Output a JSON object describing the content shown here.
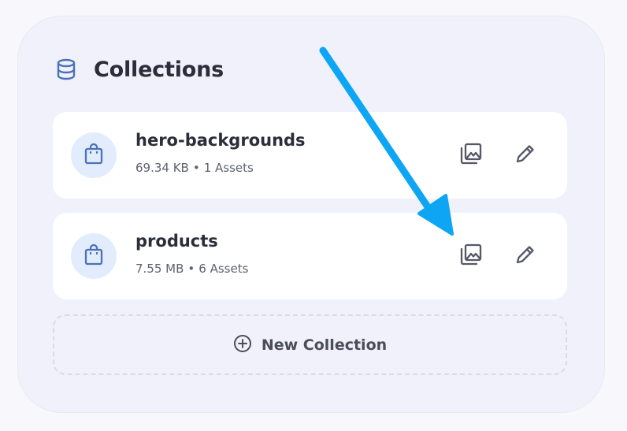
{
  "colors": {
    "page_bg": "#f7f7fc",
    "panel_bg": "#f0f1fa",
    "card_bg": "#ffffff",
    "avatar_bg": "#e3ecfc",
    "accent_blue": "#4a72b8",
    "annotation_arrow": "#0ea5f5",
    "icon_gray": "#555866",
    "title_text": "#2b2d3a"
  },
  "header": {
    "icon": "database-icon",
    "title": "Collections"
  },
  "collections": [
    {
      "name": "hero-backgrounds",
      "size": "69.34 KB",
      "separator": "•",
      "assets": "1 Assets",
      "icon": "shopping-bag-icon",
      "actions": [
        "gallery-icon",
        "pencil-icon"
      ]
    },
    {
      "name": "products",
      "size": "7.55 MB",
      "separator": "•",
      "assets": "6 Assets",
      "icon": "shopping-bag-icon",
      "actions": [
        "gallery-icon",
        "pencil-icon"
      ]
    }
  ],
  "new_collection": {
    "icon": "plus-circle-icon",
    "label": "New Collection"
  }
}
